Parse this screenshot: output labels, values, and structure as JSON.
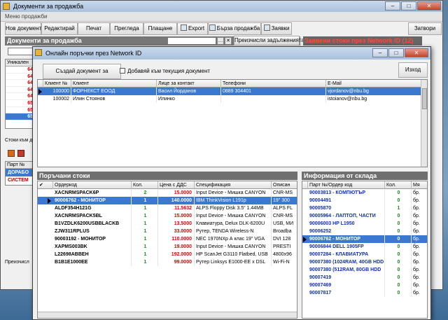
{
  "main_window": {
    "title": "Документи за продажба",
    "menu": "Меню продажби",
    "toolbar": [
      "Нов документ",
      "Редактирай",
      "Печат",
      "Прегледа",
      "Плащане",
      "Export",
      "Бърза продажба",
      "Заявки"
    ],
    "close_label": "Затвори",
    "section_title": "Документи за продажба",
    "recalc_label": "Преизчисли задълженията",
    "network_orders": "Заявени стоки през Network ID (12)",
    "left_grid_header": "Уникален",
    "left_grid_rows": [
      "64",
      "64",
      "64",
      "64",
      "64",
      "65",
      "65",
      "65"
    ],
    "stoki_label": "Стоки към д",
    "part_header": "Парт №",
    "part_rows": [
      "ДОРАБО",
      "СИСТЕМ"
    ],
    "bottom_label": "Преизчисл"
  },
  "dialog": {
    "title": "Онлайн поръчки през Network ID",
    "create_doc": "Създай документ за продажба",
    "add_to_current": "Добавяй към текущия документ",
    "exit": "Изход",
    "clients": {
      "columns": [
        "Клиент №",
        "Клиент",
        "Лице за контакт",
        "Телефони",
        "E-Mail"
      ],
      "rows": [
        {
          "id": "100000",
          "name": "ФОРНЕКСТ ЕООД",
          "contact": "Васил Йорданов",
          "phone": "0889 304401",
          "email": "vjordanov@nbu.bg"
        },
        {
          "id": "100002",
          "name": "Илин Стоянов",
          "contact": "Илинко",
          "phone": "",
          "email": "istoianov@nbu.bg"
        }
      ]
    },
    "ordered": {
      "title": "Поръчани стоки",
      "columns": [
        "Ордеркод",
        "Кол.",
        "Цена с ДДС",
        "Спецификация",
        "Описан"
      ],
      "rows": [
        {
          "code": "XACNRMSPACK6P",
          "qty": "2",
          "price": "15.0000",
          "spec": "Input Device - Мишка CANYON",
          "desc": "CNR-MS"
        },
        {
          "code": "90006762 - МОНИТОР",
          "qty": "1",
          "price": "140.0000",
          "spec": "IBM ThinkVision L191p",
          "desc": "19\" 300"
        },
        {
          "code": "ALDF354H121G",
          "qty": "1",
          "price": "11.5632",
          "spec": "ALPS Floppy Disk 3.5\" 1.44MB",
          "desc": "ALPS FL"
        },
        {
          "code": "XACNRMSPACK5BL",
          "qty": "1",
          "price": "15.0000",
          "spec": "Input Device - Мишка CANYON",
          "desc": "CNR-MS"
        },
        {
          "code": "B1VZDLK6200USBBLACKB",
          "qty": "1",
          "price": "13.5000",
          "spec": "Клавиатура, Delux DLK-6200U",
          "desc": "USB, МИ"
        },
        {
          "code": "ZJW311RPLUS",
          "qty": "1",
          "price": "33.0000",
          "spec": "Рутер, TENDA Wireless-N",
          "desc": "Broadba"
        },
        {
          "code": "90003192 - МОНИТОР",
          "qty": "1",
          "price": "110.0000",
          "spec": "NEC 1970NXp А клас 19\" VGA",
          "desc": "DVI 128"
        },
        {
          "code": "XAPMS003BK",
          "qty": "1",
          "price": "19.0000",
          "spec": "Input Device - Мишка CANYON",
          "desc": "PRESTI"
        },
        {
          "code": "L22698ABBEH",
          "qty": "1",
          "price": "192.0000",
          "spec": "HP ScanJet G3110 Flatbed, USB",
          "desc": "4800x96"
        },
        {
          "code": "B1B1E1000EE",
          "qty": "1",
          "price": "99.0000",
          "spec": "Рутер Linksys E1000-EE x DSL",
          "desc": "Wi-Fi-N"
        }
      ]
    },
    "stock": {
      "title": "Информация от склада",
      "columns": [
        "Парт №/Ордер код",
        "Кол.",
        "Мя"
      ],
      "rows": [
        {
          "code": "90003813 - КОМПЮТЪР",
          "qty": "0",
          "unit": "бр."
        },
        {
          "code": "90004491",
          "qty": "0",
          "unit": "бр."
        },
        {
          "code": "90005870",
          "qty": "1",
          "unit": "бр."
        },
        {
          "code": "90005964 - ЛАПТОП, ЧАСТИ",
          "qty": "0",
          "unit": "бр."
        },
        {
          "code": "90006003 HP L1950",
          "qty": "0",
          "unit": "бр."
        },
        {
          "code": "90006252",
          "qty": "0",
          "unit": "бр."
        },
        {
          "code": "90006762 - МОНИТОР",
          "qty": "0",
          "unit": "бр."
        },
        {
          "code": "90006844 DELL 1905FP",
          "qty": "0",
          "unit": "бр."
        },
        {
          "code": "90007284 - КЛАВИАТУРА",
          "qty": "0",
          "unit": "бр."
        },
        {
          "code": "90007380 (1024RAM, 40GB HDD",
          "qty": "0",
          "unit": "бр."
        },
        {
          "code": "90007380 (512RAM, 80GB HDD",
          "qty": "0",
          "unit": "бр."
        },
        {
          "code": "90007419",
          "qty": "0",
          "unit": "бр."
        },
        {
          "code": "90007469",
          "qty": "0",
          "unit": "бр."
        },
        {
          "code": "90007817",
          "qty": "0",
          "unit": "бр."
        }
      ]
    }
  },
  "colors": {
    "accent": "#3b78d0",
    "header_bar": "#6f6f6f",
    "alert_red": "#ff4a3a",
    "qty_green": "#1a8a1a",
    "price_red": "#d00000",
    "code_blue": "#1030b0"
  }
}
